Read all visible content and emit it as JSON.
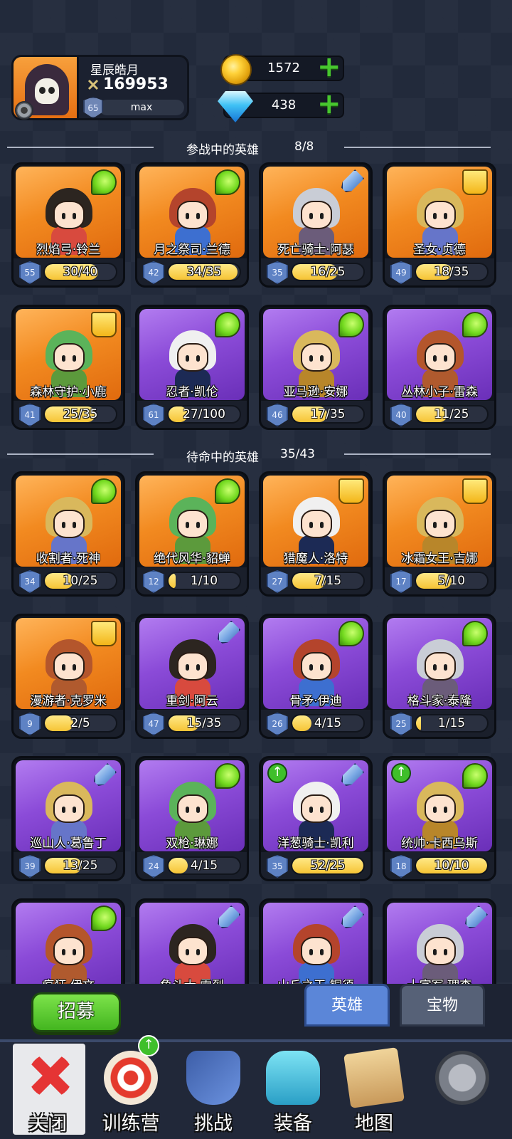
{
  "player": {
    "name": "星辰皓月",
    "power": "169953",
    "level": "65",
    "level_status": "max"
  },
  "currency": {
    "gold": "1572",
    "gems": "438"
  },
  "sections": {
    "active": {
      "title": "参战中的英雄",
      "count": "8/8"
    },
    "standby": {
      "title": "待命中的英雄",
      "count": "35/43"
    }
  },
  "active_heroes": [
    {
      "name": "烈焰弓·铃兰",
      "level": "55",
      "progress": "30/40",
      "fill": 0.75,
      "bg": "orange",
      "class": "wing"
    },
    {
      "name": "月之祭司·兰德",
      "level": "42",
      "progress": "34/35",
      "fill": 0.97,
      "bg": "orange",
      "class": "wing"
    },
    {
      "name": "死亡骑士·阿瑟",
      "level": "35",
      "progress": "16/25",
      "fill": 0.64,
      "bg": "orange",
      "class": "sword"
    },
    {
      "name": "圣女·贞德",
      "level": "49",
      "progress": "18/35",
      "fill": 0.51,
      "bg": "orange",
      "class": "book"
    },
    {
      "name": "森林守护·小鹿",
      "level": "41",
      "progress": "25/35",
      "fill": 0.71,
      "bg": "orange",
      "class": "book"
    },
    {
      "name": "忍者·凯伦",
      "level": "61",
      "progress": "27/100",
      "fill": 0.27,
      "bg": "purple",
      "class": "wing"
    },
    {
      "name": "亚马逊·安娜",
      "level": "46",
      "progress": "17/35",
      "fill": 0.49,
      "bg": "purple",
      "class": "wing"
    },
    {
      "name": "丛林小子·雷森",
      "level": "40",
      "progress": "11/25",
      "fill": 0.44,
      "bg": "purple",
      "class": "wing"
    }
  ],
  "standby_heroes": [
    {
      "name": "收割者·死神",
      "level": "34",
      "progress": "10/25",
      "fill": 0.4,
      "bg": "orange",
      "class": "wing",
      "upgrade": false
    },
    {
      "name": "绝代风华·貂蝉",
      "level": "12",
      "progress": "1/10",
      "fill": 0.1,
      "bg": "orange",
      "class": "wing",
      "upgrade": false
    },
    {
      "name": "猎魔人·洛特",
      "level": "27",
      "progress": "7/15",
      "fill": 0.47,
      "bg": "orange",
      "class": "book",
      "upgrade": false
    },
    {
      "name": "冰霜女王·吉娜",
      "level": "17",
      "progress": "5/10",
      "fill": 0.5,
      "bg": "orange",
      "class": "book",
      "upgrade": false
    },
    {
      "name": "漫游者·克罗米",
      "level": "9",
      "progress": "2/5",
      "fill": 0.4,
      "bg": "orange",
      "class": "book",
      "upgrade": false
    },
    {
      "name": "重剑·阿云",
      "level": "47",
      "progress": "15/35",
      "fill": 0.43,
      "bg": "purple",
      "class": "sword",
      "upgrade": false
    },
    {
      "name": "骨矛·伊迪",
      "level": "26",
      "progress": "4/15",
      "fill": 0.27,
      "bg": "purple",
      "class": "wing",
      "upgrade": false
    },
    {
      "name": "格斗家·泰隆",
      "level": "25",
      "progress": "1/15",
      "fill": 0.07,
      "bg": "purple",
      "class": "wing",
      "upgrade": false
    },
    {
      "name": "巡山人·葛鲁丁",
      "level": "39",
      "progress": "13/25",
      "fill": 0.52,
      "bg": "purple",
      "class": "sword",
      "upgrade": false
    },
    {
      "name": "双枪·琳娜",
      "level": "24",
      "progress": "4/15",
      "fill": 0.27,
      "bg": "purple",
      "class": "wing",
      "upgrade": false
    },
    {
      "name": "洋葱骑士·凯利",
      "level": "35",
      "progress": "52/25",
      "fill": 1.0,
      "bg": "purple",
      "class": "sword",
      "upgrade": true
    },
    {
      "name": "统帅·卡西乌斯",
      "level": "18",
      "progress": "10/10",
      "fill": 1.0,
      "bg": "purple",
      "class": "wing",
      "upgrade": true
    },
    {
      "name": "疯狂·伊文",
      "level": "",
      "progress": "",
      "fill": 0,
      "bg": "purple",
      "class": "wing",
      "upgrade": false
    },
    {
      "name": "角斗士·雷烈",
      "level": "",
      "progress": "",
      "fill": 0,
      "bg": "purple",
      "class": "sword",
      "upgrade": false
    },
    {
      "name": "山丘之王·铜须",
      "level": "",
      "progress": "",
      "fill": 0,
      "bg": "purple",
      "class": "sword",
      "upgrade": false
    },
    {
      "name": "十字军·理查",
      "level": "",
      "progress": "",
      "fill": 0,
      "bg": "purple",
      "class": "sword",
      "upgrade": false
    }
  ],
  "buttons": {
    "recruit": "招募",
    "tab_heroes": "英雄",
    "tab_treasures": "宝物"
  },
  "nav": [
    {
      "label": "关闭",
      "icon": "close-icon"
    },
    {
      "label": "训练营",
      "icon": "target-icon"
    },
    {
      "label": "挑战",
      "icon": "sword-shield-icon"
    },
    {
      "label": "装备",
      "icon": "armor-icon"
    },
    {
      "label": "地图",
      "icon": "map-icon"
    },
    {
      "label": "",
      "icon": "lock-icon"
    }
  ]
}
